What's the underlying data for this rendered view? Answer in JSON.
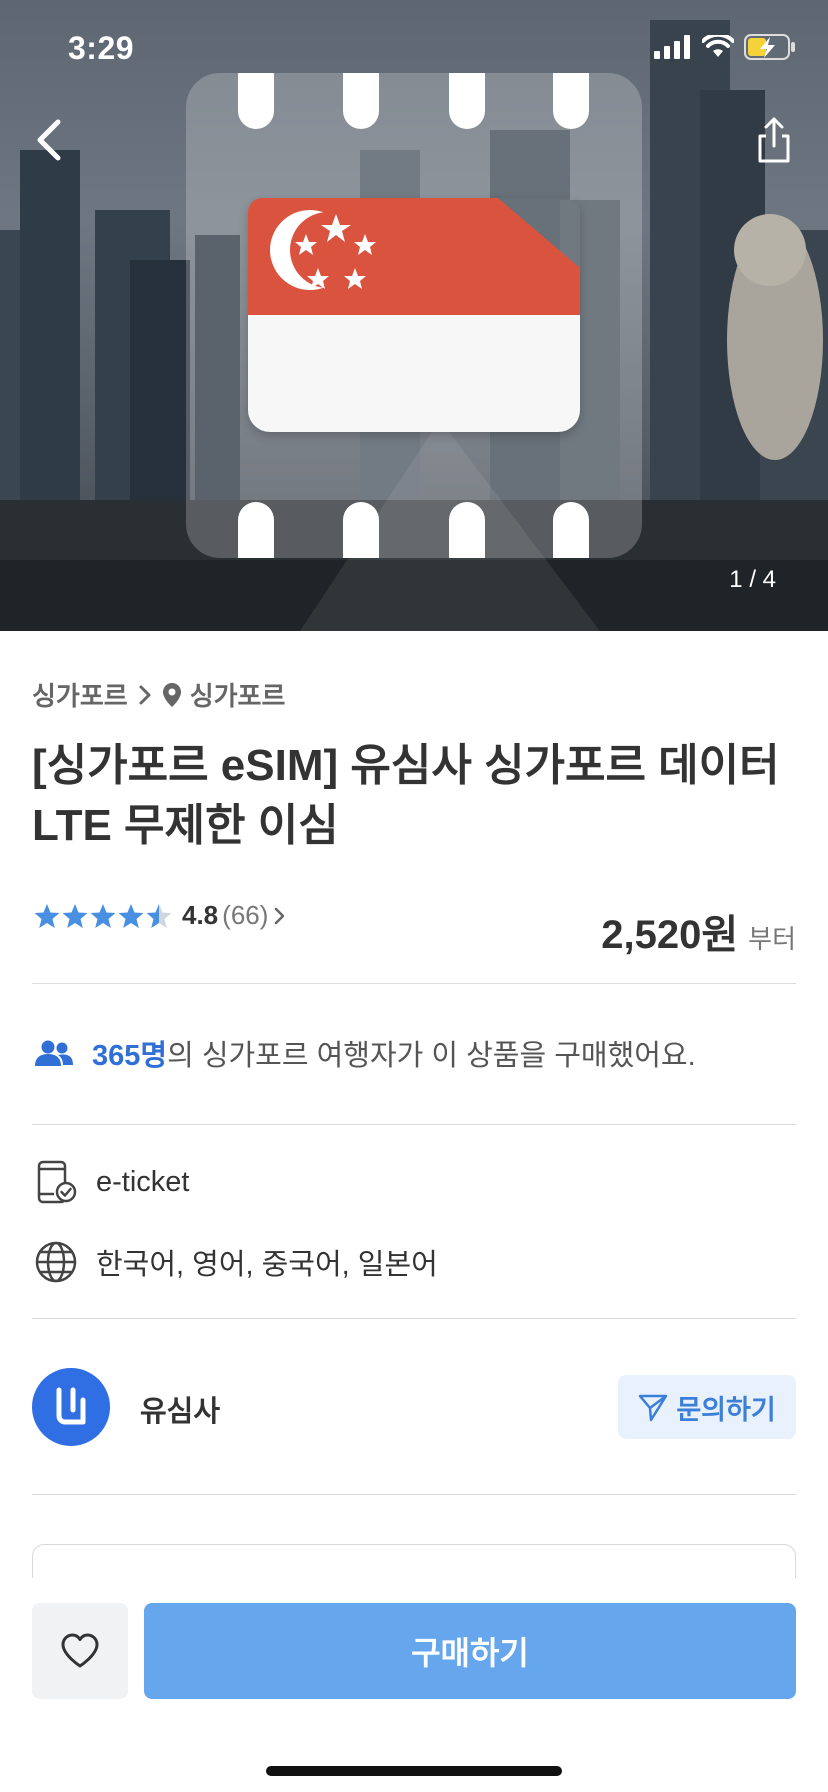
{
  "status_bar": {
    "time": "3:29"
  },
  "hero": {
    "page_counter": "1 / 4",
    "flag_country": "Singapore"
  },
  "breadcrumb": {
    "first": "싱가포르",
    "second": "싱가포르"
  },
  "product": {
    "title": "[싱가포르 eSIM] 유심사 싱가포르 데이터 LTE 무제한 이심",
    "rating_score": "4.8",
    "rating_count": "(66)",
    "rating_stars": 4.5,
    "price": "2,520원",
    "price_suffix": "부터"
  },
  "buyers": {
    "count": "365명",
    "text": "의 싱가포르 여행자가 이 상품을 구매했어요."
  },
  "info": {
    "ticket_type": "e-ticket",
    "languages": "한국어, 영어, 중국어, 일본어"
  },
  "seller": {
    "name": "유심사",
    "inquiry_label": "문의하기"
  },
  "actions": {
    "buy_label": "구매하기"
  },
  "colors": {
    "accent": "#2f6fd6",
    "buy_button": "#65a6ec",
    "star": "#4a90e2",
    "flag_red": "#d9533e"
  },
  "icons": [
    "back-arrow-icon",
    "share-icon",
    "chevron-right-icon",
    "location-pin-icon",
    "people-icon",
    "mobile-ticket-icon",
    "globe-icon",
    "paper-plane-icon",
    "heart-icon"
  ]
}
